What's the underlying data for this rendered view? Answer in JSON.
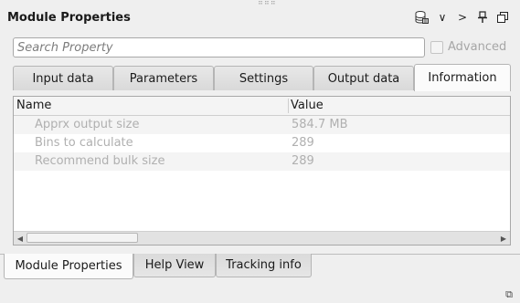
{
  "title": "Module Properties",
  "toolbar": {
    "icons": [
      "database-icon",
      "chevron-down-icon",
      "chevron-right-icon",
      "pin-icon",
      "float-icon"
    ],
    "chevron_down": "∨",
    "chevron_right": ">",
    "pin": "⊥",
    "float": "⧉"
  },
  "search": {
    "placeholder": "Search Property",
    "value": ""
  },
  "advanced": {
    "label": "Advanced",
    "checked": false,
    "enabled": false
  },
  "tabs": [
    {
      "label": "Input data"
    },
    {
      "label": "Parameters"
    },
    {
      "label": "Settings"
    },
    {
      "label": "Output data"
    },
    {
      "label": "Information",
      "active": true
    }
  ],
  "table": {
    "columns": [
      "Name",
      "Value"
    ],
    "rows": [
      {
        "name": "Apprx output size",
        "value": "584.7 MB"
      },
      {
        "name": "Bins to calculate",
        "value": "289"
      },
      {
        "name": "Recommend bulk size",
        "value": "289"
      }
    ]
  },
  "bottom_tabs": [
    {
      "label": "Module Properties",
      "active": true
    },
    {
      "label": "Help View"
    },
    {
      "label": "Tracking info"
    }
  ],
  "colors": {
    "background": "#efefef",
    "disabled_text": "#b0b0b0",
    "border": "#a8a8a8"
  }
}
